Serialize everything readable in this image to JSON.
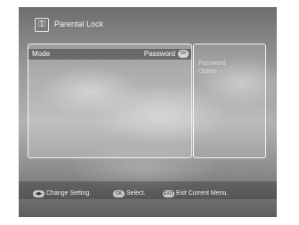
{
  "header": {
    "title": "Parental Lock",
    "icon": "lock-menu-icon"
  },
  "main_panel": {
    "rows": [
      {
        "label": "Mode",
        "value": "Password",
        "badge": "OK"
      }
    ]
  },
  "side_panel": {
    "lines": [
      "Password",
      "Option"
    ]
  },
  "footer": {
    "hints": [
      {
        "key": "◀▶",
        "label": "Change Setting."
      },
      {
        "key": "OK",
        "label": "Select."
      },
      {
        "key": "EXIT",
        "label": "Exit Current Menu."
      }
    ]
  }
}
